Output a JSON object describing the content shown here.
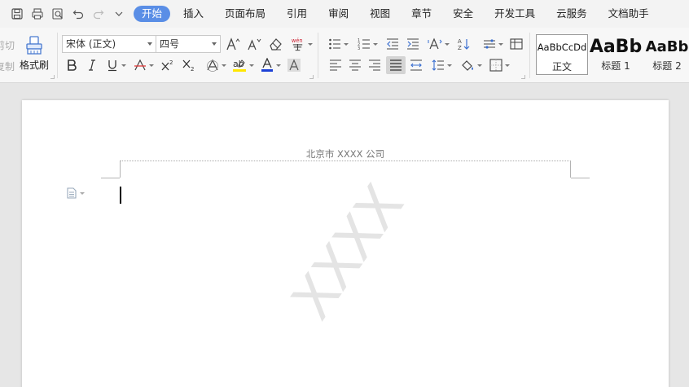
{
  "menubar": {
    "quick_access": [
      "save",
      "print",
      "print-preview",
      "undo",
      "redo",
      "customize"
    ],
    "tabs": [
      {
        "label": "开始",
        "active": true
      },
      {
        "label": "插入"
      },
      {
        "label": "页面布局"
      },
      {
        "label": "引用"
      },
      {
        "label": "审阅"
      },
      {
        "label": "视图"
      },
      {
        "label": "章节"
      },
      {
        "label": "安全"
      },
      {
        "label": "开发工具"
      },
      {
        "label": "云服务"
      },
      {
        "label": "文档助手"
      }
    ]
  },
  "ribbon": {
    "clipboard": {
      "cut_fragment": "剪切",
      "copy_fragment": "复制",
      "format_painter_label": "格式刷"
    },
    "font": {
      "family": "宋体 (正文)",
      "size": "四号"
    },
    "styles": [
      {
        "preview": "AaBbCcDd",
        "name": "正文",
        "selected": true
      },
      {
        "preview": "AaBb",
        "name": "标题 1"
      },
      {
        "preview": "AaBb",
        "name": "标题 2"
      }
    ],
    "colors": {
      "accent": "#5a8ee6",
      "highlight": "#ffe600",
      "font_color": "#1d41d6",
      "strike": "#e23a3a"
    }
  },
  "document": {
    "header_text": "北京市 XXXX 公司",
    "watermark": "XXXX"
  }
}
